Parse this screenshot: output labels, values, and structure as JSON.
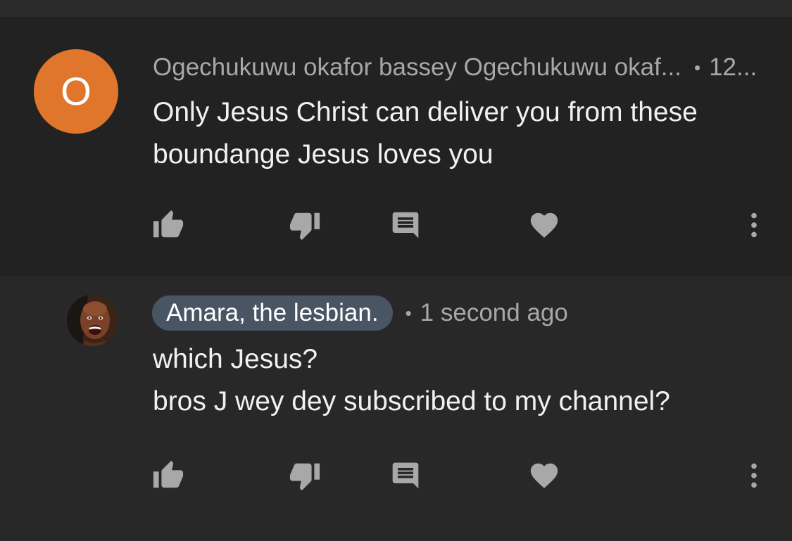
{
  "comments": [
    {
      "avatar_letter": "O",
      "avatar_color": "#e0762c",
      "author": "Ogechukuwu okafor bassey Ogechukuwu okaf...",
      "time": "12...",
      "lines": [
        "Only Jesus Christ can deliver you from these",
        "boundange Jesus loves you"
      ]
    },
    {
      "author": "Amara, the lesbian.",
      "author_chip_color": "#4a5564",
      "time": "1 second ago",
      "lines": [
        "which Jesus?",
        "bros J wey dey subscribed to my channel?"
      ]
    }
  ],
  "separator": "•",
  "icons": [
    "thumbs-up-icon",
    "thumbs-down-icon",
    "reply-icon",
    "heart-icon",
    "more-vert-icon"
  ]
}
